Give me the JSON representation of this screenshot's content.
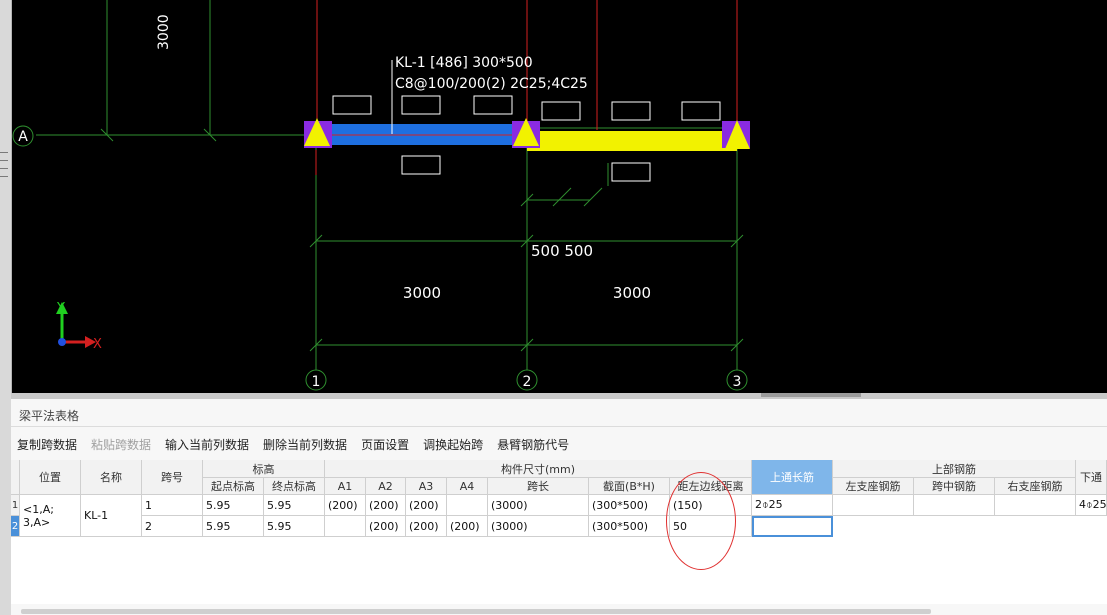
{
  "canvas": {
    "vertical_dim_label": "3000",
    "beam_label_line1": "KL-1 [486] 300*500",
    "beam_label_line2": "C8@100/200(2) 2C25;4C25",
    "axis_a": "A",
    "axis_1": "1",
    "axis_2": "2",
    "axis_3": "3",
    "mid_dim": "500 500",
    "span_dim_1": "3000",
    "span_dim_2": "3000",
    "coord_y": "Y",
    "coord_x": "X",
    "colors": {
      "background": "#000000",
      "grid": "#2f8f2f",
      "red": "#d42020",
      "beam_blue": "#1e6fe0",
      "beam_yellow": "#f2f200",
      "support": "#8a2be2"
    }
  },
  "panel": {
    "title": "梁平法表格",
    "toolbar": {
      "copy": "复制跨数据",
      "paste": "粘贴跨数据",
      "input_col": "输入当前列数据",
      "delete_col": "删除当前列数据",
      "page_setup": "页面设置",
      "swap_start": "调换起始跨",
      "cantilever": "悬臂钢筋代号"
    },
    "headers": {
      "position": "位置",
      "name": "名称",
      "span_no": "跨号",
      "elevation": "标高",
      "start_elev": "起点标高",
      "end_elev": "终点标高",
      "dimensions": "构件尺寸(mm)",
      "a1": "A1",
      "a2": "A2",
      "a3": "A3",
      "a4": "A4",
      "span_len": "跨长",
      "section": "截面(B*H)",
      "left_offset": "距左边线距离",
      "top_continuous": "上通长筋",
      "top_rebar": "上部钢筋",
      "left_support": "左支座钢筋",
      "mid_span": "跨中钢筋",
      "right_support": "右支座钢筋",
      "bottom_cut": "下通"
    },
    "rows": [
      {
        "rownum": "1",
        "position_line1": "<1,A;",
        "name": "KL-1",
        "span": "1",
        "start": "5.95",
        "end": "5.95",
        "a1": "(200)",
        "a2": "(200)",
        "a3": "(200)",
        "a4": "",
        "span_len": "(3000)",
        "section": "(300*500)",
        "offset": "(150)",
        "top_cont": "2⌽25",
        "bottom_cut": "4⌽25"
      },
      {
        "rownum": "2",
        "position_line2": "3,A>",
        "span": "2",
        "start": "5.95",
        "end": "5.95",
        "a1": "",
        "a2": "(200)",
        "a3": "(200)",
        "a4": "(200)",
        "span_len": "(3000)",
        "section": "(300*500)",
        "offset": "50",
        "top_cont": ""
      }
    ]
  }
}
